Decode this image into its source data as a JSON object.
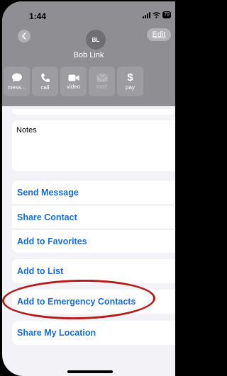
{
  "status_bar": {
    "time": "1:44",
    "battery": "70"
  },
  "contact": {
    "initials": "BL",
    "name": "Bob Link"
  },
  "header": {
    "edit_label": "Edit"
  },
  "actions": [
    {
      "label": "mess...",
      "icon": "message-icon",
      "enabled": true
    },
    {
      "label": "call",
      "icon": "phone-icon",
      "enabled": true
    },
    {
      "label": "video",
      "icon": "video-icon",
      "enabled": true
    },
    {
      "label": "mail",
      "icon": "mail-icon",
      "enabled": false
    },
    {
      "label": "pay",
      "icon": "dollar-icon",
      "enabled": true
    }
  ],
  "notes": {
    "label": "Notes"
  },
  "options_group1": [
    {
      "label": "Send Message"
    },
    {
      "label": "Share Contact"
    },
    {
      "label": "Add to Favorites"
    }
  ],
  "options_group2": [
    {
      "label": "Add to List"
    }
  ],
  "options_group3": [
    {
      "label": "Add to Emergency Contacts"
    }
  ],
  "options_group4": [
    {
      "label": "Share My Location"
    }
  ],
  "colors": {
    "link": "#1a6bd6",
    "header": "#8e8e93",
    "annotation": "#b51c1c"
  }
}
